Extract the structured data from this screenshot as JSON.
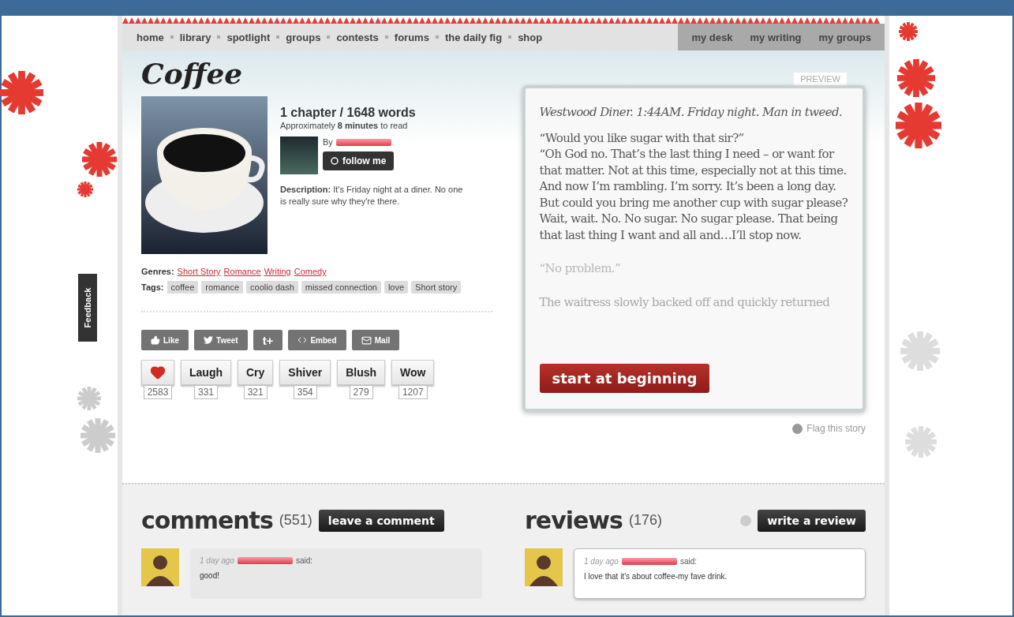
{
  "nav": {
    "left": [
      "home",
      "library",
      "spotlight",
      "groups",
      "contests",
      "forums",
      "the daily fig",
      "shop"
    ],
    "right": [
      "my desk",
      "my writing",
      "my groups"
    ]
  },
  "feedback_tab": "Feedback",
  "story": {
    "title": "Coffee",
    "stats": "1 chapter / 1648 words",
    "read_time": "Approximately **8 minutes** to read",
    "by": "By",
    "follow_button": "follow me",
    "description": "**Description:** It's Friday night at a diner. No one is really sure why they're there.",
    "genres_label": "Genres:",
    "genres": [
      "Short Story",
      "Romance",
      "Writing",
      "Comedy"
    ],
    "tags_label": "Tags:",
    "tags": [
      "coffee",
      "romance",
      "coolio dash",
      "missed connection",
      "love",
      "Short story"
    ]
  },
  "share_buttons": [
    {
      "kind": "like",
      "label": "Like"
    },
    {
      "kind": "tweet",
      "label": "Tweet"
    },
    {
      "kind": "plus",
      "label": "t+"
    },
    {
      "kind": "embed",
      "label": "Embed"
    },
    {
      "kind": "mail",
      "label": "Mail"
    }
  ],
  "reactions": [
    {
      "kind": "heart",
      "count": "2583"
    },
    {
      "kind": "word",
      "label": "Laugh",
      "count": "331"
    },
    {
      "kind": "word",
      "label": "Cry",
      "count": "321"
    },
    {
      "kind": "word",
      "label": "Shiver",
      "count": "354"
    },
    {
      "kind": "word",
      "label": "Blush",
      "count": "279"
    },
    {
      "kind": "word",
      "label": "Wow",
      "count": "1207"
    }
  ],
  "preview": {
    "tab": "PREVIEW",
    "paragraphs": [
      {
        "kind": "italic",
        "text": "Westwood Diner. 1:44AM. Friday night. Man in tweed."
      },
      {
        "kind": "normal",
        "text": "“Would you like sugar with that sir?”"
      },
      {
        "kind": "continued",
        "text": "“Oh God no. That’s the last thing I need – or want for that matter. Not at this time, especially not at this time. And now I’m rambling. I’m sorry. It’s been a long day. But could you bring me another cup with sugar please? Wait, wait. No. No sugar. No sugar please. That being that last thing I want and all and…I’ll stop now."
      },
      {
        "kind": "faded",
        "text": "“No problem.”"
      },
      {
        "kind": "ghost",
        "text": "The waitress slowly backed off and quickly returned"
      }
    ],
    "start_button": "start at beginning"
  },
  "flag": "Flag this story",
  "comments": {
    "title": "comments",
    "count": "(551)",
    "button": "leave a comment",
    "items": [
      {
        "time": "1 day ago",
        "said": "said:",
        "text": "good!"
      }
    ]
  },
  "reviews": {
    "title": "reviews",
    "count": "(176)",
    "button": "write a review",
    "items": [
      {
        "time": "1 day ago",
        "said": "said:",
        "text": "I love that it's about coffee-my fave drink."
      }
    ]
  }
}
